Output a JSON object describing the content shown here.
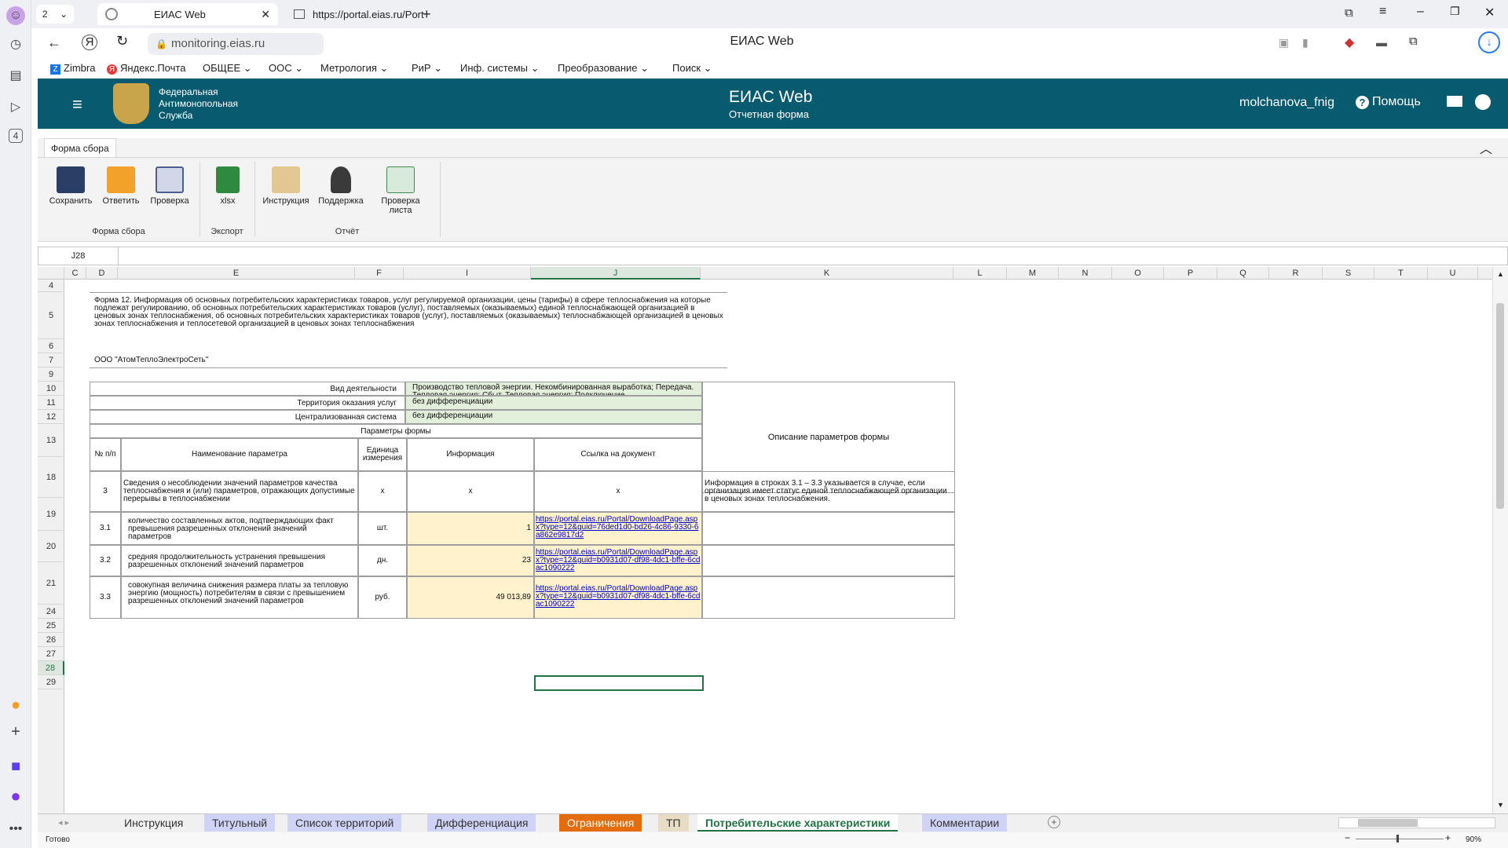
{
  "browser": {
    "tab_count": "2",
    "tabs": [
      {
        "label": "ЕИАС Web"
      },
      {
        "label": "https://portal.eias.ru/Port"
      }
    ],
    "address": "monitoring.eias.ru",
    "page_title": "ЕИАС Web",
    "bookmarks": [
      "Zimbra",
      "Яндекс.Почта",
      "ОБЩЕЕ",
      "ООС",
      "Метрология",
      "РиР",
      "Инф. системы",
      "Преобразование",
      "Поиск"
    ]
  },
  "app": {
    "org_name": [
      "Федеральная",
      "Антимонопольная",
      "Служба"
    ],
    "title": "ЕИАС Web",
    "subtitle": "Отчетная форма",
    "user": "molchanova_fnig",
    "help": "Помощь",
    "brand_color": "#085a6e"
  },
  "ribbon": {
    "tab": "Форма сбора",
    "buttons": [
      {
        "label": "Сохранить",
        "icon": "save-icon"
      },
      {
        "label": "Ответить",
        "icon": "reply-icon"
      },
      {
        "label": "Проверка",
        "icon": "check-clipboard-icon"
      },
      {
        "label": "xlsx",
        "icon": "xlsx-icon"
      },
      {
        "label": "Инструкция",
        "icon": "book-icon"
      },
      {
        "label": "Поддержка",
        "icon": "support-icon"
      },
      {
        "label": "Проверка листа",
        "icon": "sheet-check-icon"
      }
    ],
    "groups": [
      "Форма сбора",
      "Экспорт",
      "Отчёт"
    ]
  },
  "formula_bar": {
    "cell_ref": "J28",
    "value": ""
  },
  "columns": [
    "C",
    "D",
    "E",
    "F",
    "I",
    "J",
    "K",
    "L",
    "M",
    "N",
    "O",
    "P",
    "Q",
    "R",
    "S",
    "T",
    "U"
  ],
  "rows": [
    "4",
    "5",
    "6",
    "7",
    "9",
    "10",
    "11",
    "12",
    "13",
    "18",
    "19",
    "20",
    "21",
    "24",
    "25",
    "26",
    "27",
    "28",
    "29"
  ],
  "sheet": {
    "form_title": "Форма 12. Информация об основных потребительских характеристиках товаров, услуг регулируемой организации, цены (тарифы) в сфере теплоснабжения на которые подлежат регулированию, об основных потребительских характеристиках товаров (услуг), поставляемых (оказываемых) единой теплоснабжающей организацией в ценовых зонах теплоснабжения, об основных потребительских характеристиках товаров (услуг), поставляемых (оказываемых) теплоснабжающей организацией в ценовых зонах теплоснабжения и теплосетевой организацией в ценовых зонах теплоснабжения",
    "org": "ООО \"АтомТеплоЭлектроСеть\"",
    "params": [
      {
        "label": "Вид деятельности",
        "value": "Производство тепловой энергии. Некомбинированная выработка; Передача. Тепловая энергия; Сбыт. Тепловая энергия; Подключение"
      },
      {
        "label": "Территория оказания услуг",
        "value": "без дифференциации"
      },
      {
        "label": "Централизованная система",
        "value": "без дифференциации"
      }
    ],
    "params_header": "Параметры формы",
    "desc_header": "Описание параметров формы",
    "headers": [
      "№ п/п",
      "Наименование параметра",
      "Единица измерения",
      "Информация",
      "Ссылка на документ"
    ],
    "rows": [
      {
        "num": "3",
        "name": "Сведения о несоблюдении значений параметров качества теплоснабжения и (или) параметров, отражающих допустимые перерывы в теплоснабжении",
        "unit": "x",
        "info": "x",
        "link": "x",
        "desc": "Информация в строках 3.1 – 3.3 указывается в случае, если организация имеет статус единой теплоснабжающей организации в ценовых зонах теплоснабжения."
      },
      {
        "num": "3.1",
        "name": "количество составленных актов, подтверждающих факт превышения разрешенных отклонений значений параметров",
        "unit": "шт.",
        "info": "1",
        "link": "https://portal.eias.ru/Portal/DownloadPage.aspx?type=12&guid=76ded1d0-bd26-4c86-9330-6a862e9817d2",
        "desc": ""
      },
      {
        "num": "3.2",
        "name": "средняя продолжительность устранения превышения разрешенных отклонений значений параметров",
        "unit": "дн.",
        "info": "23",
        "link": "https://portal.eias.ru/Portal/DownloadPage.aspx?type=12&guid=b0931d07-df98-4dc1-bffe-6cdac1090222",
        "desc": ""
      },
      {
        "num": "3.3",
        "name": "совокупная величина снижения размера платы за тепловую энергию (мощность) потребителям в связи с превышением разрешенных отклонений значений параметров",
        "unit": "руб.",
        "info": "49 013,89",
        "link": "https://portal.eias.ru/Portal/DownloadPage.aspx?type=12&guid=b0931d07-df98-4dc1-bffe-6cdac1090222",
        "desc": ""
      }
    ]
  },
  "sheet_tabs": [
    {
      "label": "Инструкция",
      "color": "#f0f0f0"
    },
    {
      "label": "Титульный",
      "color": "#cfd4f6"
    },
    {
      "label": "Список территорий",
      "color": "#cfd4f6"
    },
    {
      "label": "Дифференциация",
      "color": "#cfd4f6"
    },
    {
      "label": "Ограничения",
      "color": "#e46c0a"
    },
    {
      "label": "ТП",
      "color": "#e8dcc4"
    },
    {
      "label": "Потребительские характеристики",
      "color": "#ffffff"
    },
    {
      "label": "Комментарии",
      "color": "#cfd4f6"
    }
  ],
  "status": {
    "text": "Готово",
    "zoom": "90%"
  }
}
